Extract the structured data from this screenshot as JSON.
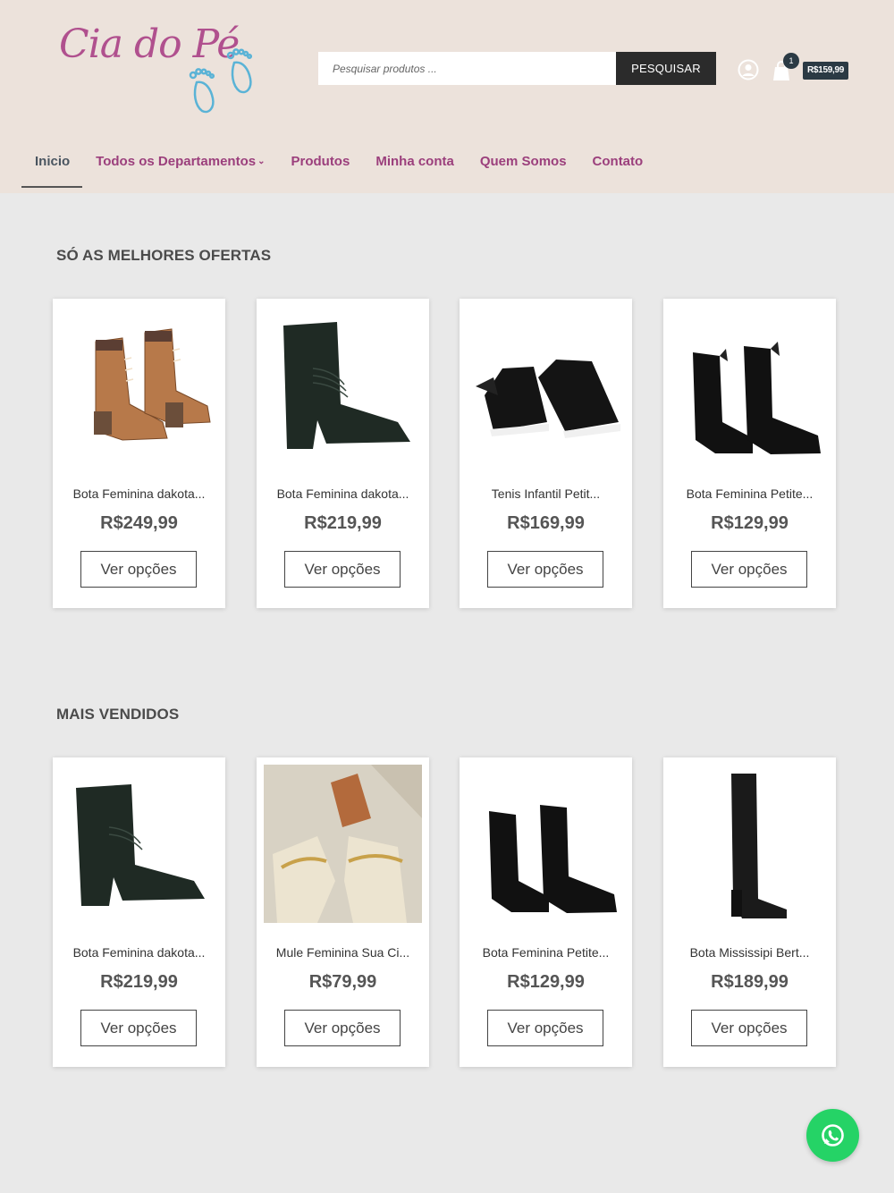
{
  "header": {
    "logo_text": "Cia do Pé",
    "search": {
      "placeholder": "Pesquisar produtos ...",
      "button_label": "PESQUISAR"
    },
    "cart": {
      "count": "1",
      "total": "R$159,99"
    }
  },
  "nav": {
    "items": [
      {
        "label": "Inicio",
        "active": true
      },
      {
        "label": "Todos os Departamentos",
        "has_dropdown": true
      },
      {
        "label": "Produtos"
      },
      {
        "label": "Minha conta"
      },
      {
        "label": "Quem Somos"
      },
      {
        "label": "Contato"
      }
    ]
  },
  "sections": [
    {
      "title": "SÓ AS MELHORES OFERTAS",
      "products": [
        {
          "name": "Bota Feminina dakota...",
          "price": "R$249,99",
          "button": "Ver opções",
          "image": "brown-lace-up-ankle-boots"
        },
        {
          "name": "Bota Feminina dakota...",
          "price": "R$219,99",
          "button": "Ver opções",
          "image": "black-block-heel-ankle-boot"
        },
        {
          "name": "Tenis Infantil Petit...",
          "price": "R$169,99",
          "button": "Ver opções",
          "image": "black-velcro-sneakers"
        },
        {
          "name": "Bota Feminina Petite...",
          "price": "R$129,99",
          "button": "Ver opções",
          "image": "black-chelsea-boots"
        }
      ]
    },
    {
      "title": "MAIS VENDIDOS",
      "products": [
        {
          "name": "Bota Feminina dakota...",
          "price": "R$219,99",
          "button": "Ver opções",
          "image": "black-block-heel-ankle-boot"
        },
        {
          "name": "Mule Feminina Sua Ci...",
          "price": "R$79,99",
          "button": "Ver opções",
          "image": "beige-chain-mules"
        },
        {
          "name": "Bota Feminina Petite...",
          "price": "R$129,99",
          "button": "Ver opções",
          "image": "black-chelsea-boots"
        },
        {
          "name": "Bota Mississipi Bert...",
          "price": "R$189,99",
          "button": "Ver opções",
          "image": "black-knee-high-boot"
        }
      ]
    }
  ],
  "colors": {
    "header_bg": "#ece2db",
    "nav_link": "#9b3f7c",
    "page_bg": "#e9e9e9",
    "whatsapp": "#25d366"
  },
  "icons": [
    "user-icon",
    "cart-icon",
    "whatsapp-icon"
  ]
}
